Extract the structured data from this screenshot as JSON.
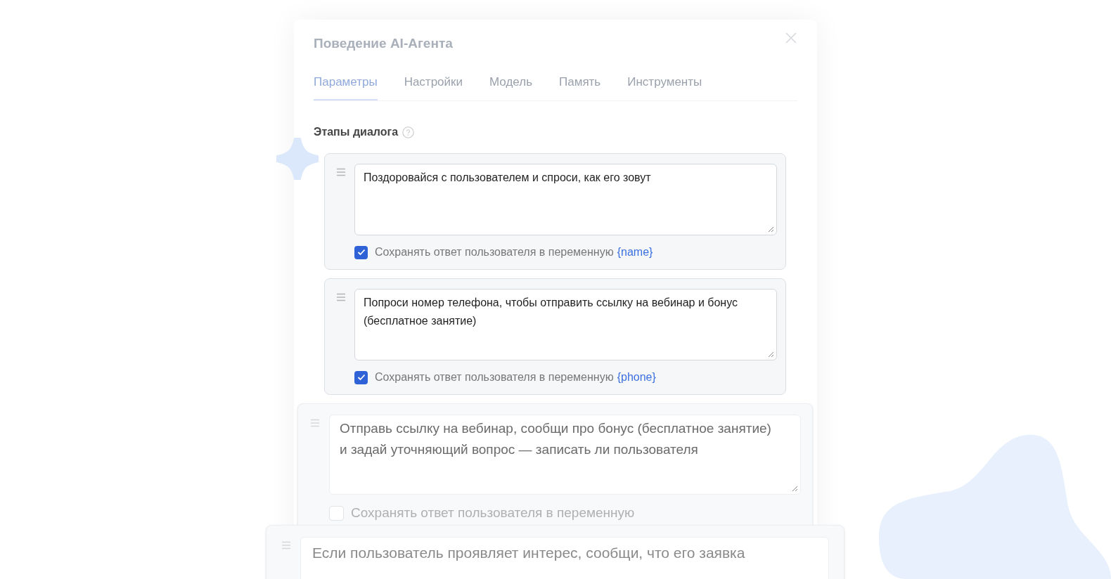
{
  "dialog": {
    "title": "Поведение AI-Агента"
  },
  "tabs": [
    {
      "label": "Параметры",
      "selected": true
    },
    {
      "label": "Настройки",
      "selected": false
    },
    {
      "label": "Модель",
      "selected": false
    },
    {
      "label": "Память",
      "selected": false
    },
    {
      "label": "Инструменты",
      "selected": false
    }
  ],
  "section": {
    "title": "Этапы диалога"
  },
  "steps": [
    {
      "text": "Поздоровайся с пользователем и спроси, как его зовут",
      "save_label": "Сохранять ответ пользователя в переменную",
      "checked": true,
      "variable": "{name}"
    },
    {
      "text": "Попроси номер телефона, чтобы отправить ссылку на вебинар и бонус (бесплатное занятие)",
      "save_label": "Сохранять ответ пользователя в переменную",
      "checked": true,
      "variable": "{phone}"
    },
    {
      "text": "Отправь ссылку на вебинар, сообщи про бонус (бесплатное занятие) и задай уточняющий вопрос — записать ли пользователя",
      "save_label": "Сохранять ответ пользователя в переменную",
      "checked": false
    },
    {
      "text": "Если пользователь проявляет интерес, сообщи, что его заявка"
    }
  ]
}
